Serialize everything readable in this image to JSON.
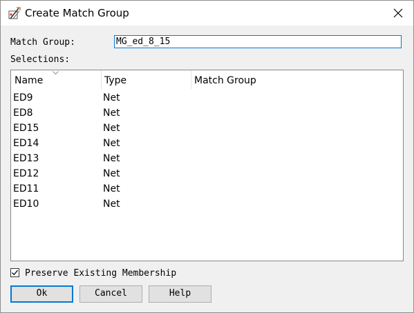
{
  "window": {
    "title": "Create Match Group",
    "title_icon": "match-group-icon",
    "close_icon": "close-icon"
  },
  "form": {
    "match_group_label": "Match Group:",
    "match_group_value": "MG_ed_8_15",
    "selections_label": "Selections:"
  },
  "table": {
    "columns": [
      "Name",
      "Type",
      "Match Group"
    ],
    "sorted_column": "Name",
    "rows": [
      {
        "name": "ED9",
        "type": "Net",
        "match_group": ""
      },
      {
        "name": "ED8",
        "type": "Net",
        "match_group": ""
      },
      {
        "name": "ED15",
        "type": "Net",
        "match_group": ""
      },
      {
        "name": "ED14",
        "type": "Net",
        "match_group": ""
      },
      {
        "name": "ED13",
        "type": "Net",
        "match_group": ""
      },
      {
        "name": "ED12",
        "type": "Net",
        "match_group": ""
      },
      {
        "name": "ED11",
        "type": "Net",
        "match_group": ""
      },
      {
        "name": "ED10",
        "type": "Net",
        "match_group": ""
      }
    ]
  },
  "options": {
    "preserve_label": "Preserve Existing Membership",
    "preserve_checked": true
  },
  "buttons": {
    "ok": "Ok",
    "cancel": "Cancel",
    "help": "Help"
  },
  "colors": {
    "focus_accent": "#0078d7"
  }
}
